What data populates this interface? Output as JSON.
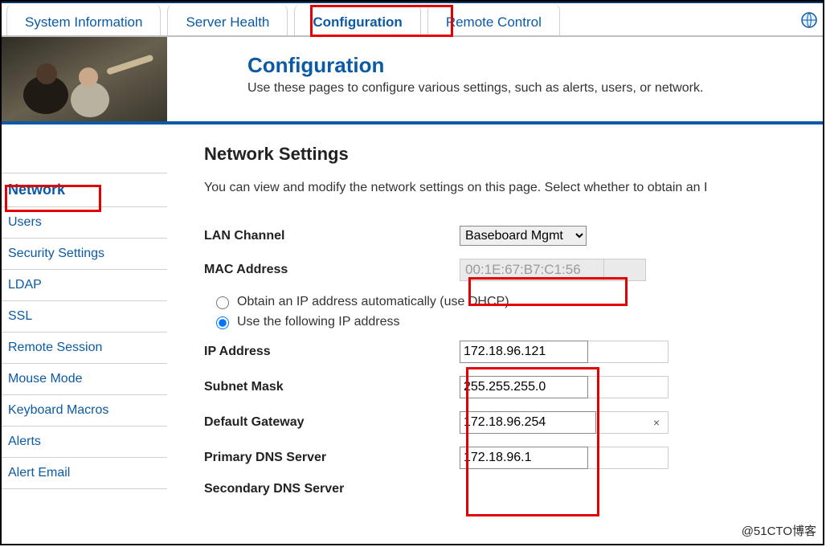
{
  "tabs": [
    {
      "label": "System Information"
    },
    {
      "label": "Server Health"
    },
    {
      "label": "Configuration"
    },
    {
      "label": "Remote Control"
    }
  ],
  "header": {
    "title": "Configuration",
    "subtitle": "Use these pages to configure various settings, such as alerts, users, or network."
  },
  "sidebar": {
    "items": [
      {
        "label": "Network"
      },
      {
        "label": "Users"
      },
      {
        "label": "Security Settings"
      },
      {
        "label": "LDAP"
      },
      {
        "label": "SSL"
      },
      {
        "label": "Remote Session"
      },
      {
        "label": "Mouse Mode"
      },
      {
        "label": "Keyboard Macros"
      },
      {
        "label": "Alerts"
      },
      {
        "label": "Alert Email"
      }
    ]
  },
  "content": {
    "title": "Network Settings",
    "description": "You can view and modify the network settings on this page. Select whether to obtain an I",
    "lan_channel_label": "LAN Channel",
    "lan_channel_value": "Baseboard Mgmt",
    "mac_label": "MAC Address",
    "mac_value": "00:1E:67:B7:C1:56",
    "radio_dhcp": "Obtain an IP address automatically (use DHCP)",
    "radio_static": "Use the following IP address",
    "ip_label": "IP Address",
    "ip_value": "172.18.96.121",
    "subnet_label": "Subnet Mask",
    "subnet_value": "255.255.255.0",
    "gateway_label": "Default Gateway",
    "gateway_value": "172.18.96.254",
    "gateway_clear": "×",
    "dns1_label": "Primary DNS Server",
    "dns1_value": "172.18.96.1",
    "dns2_label": "Secondary DNS Server"
  },
  "watermark": "@51CTO博客"
}
